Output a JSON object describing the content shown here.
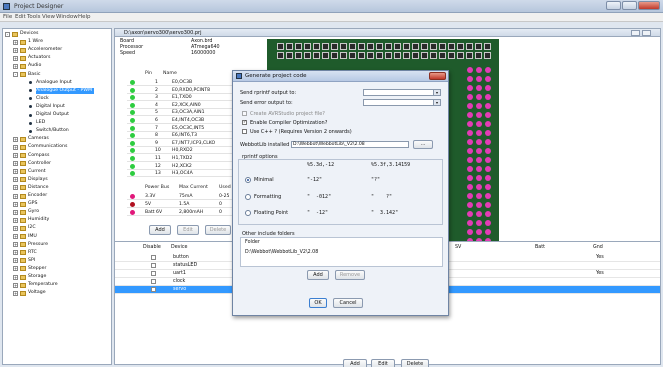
{
  "app": {
    "title": "Project Designer"
  },
  "menu": [
    "File",
    "Edit",
    "Tools",
    "View",
    "Window",
    "Help"
  ],
  "tree": [
    {
      "label": "Devices",
      "level": 0,
      "kind": "folder",
      "toggle": "-"
    },
    {
      "label": "1 Wire",
      "level": 1,
      "kind": "folder",
      "toggle": "+"
    },
    {
      "label": "Accelerometer",
      "level": 1,
      "kind": "folder",
      "toggle": "+"
    },
    {
      "label": "Actuators",
      "level": 1,
      "kind": "folder",
      "toggle": "+"
    },
    {
      "label": "Audio",
      "level": 1,
      "kind": "folder",
      "toggle": "+"
    },
    {
      "label": "Basic",
      "level": 1,
      "kind": "folder",
      "toggle": "-"
    },
    {
      "label": "Analogue Input",
      "level": 2,
      "kind": "leaf"
    },
    {
      "label": "Analogue Output - PWM",
      "level": 2,
      "kind": "leaf",
      "selected": true
    },
    {
      "label": "Clock",
      "level": 2,
      "kind": "leaf"
    },
    {
      "label": "Digital Input",
      "level": 2,
      "kind": "leaf"
    },
    {
      "label": "Digital Output",
      "level": 2,
      "kind": "leaf"
    },
    {
      "label": "LED",
      "level": 2,
      "kind": "leaf"
    },
    {
      "label": "Switch/Button",
      "level": 2,
      "kind": "leaf"
    },
    {
      "label": "Cameras",
      "level": 1,
      "kind": "folder",
      "toggle": "+"
    },
    {
      "label": "Communications",
      "level": 1,
      "kind": "folder",
      "toggle": "+"
    },
    {
      "label": "Compass",
      "level": 1,
      "kind": "folder",
      "toggle": "+"
    },
    {
      "label": "Controller",
      "level": 1,
      "kind": "folder",
      "toggle": "+"
    },
    {
      "label": "Current",
      "level": 1,
      "kind": "folder",
      "toggle": "+"
    },
    {
      "label": "Displays",
      "level": 1,
      "kind": "folder",
      "toggle": "+"
    },
    {
      "label": "Distance",
      "level": 1,
      "kind": "folder",
      "toggle": "+"
    },
    {
      "label": "Encoder",
      "level": 1,
      "kind": "folder",
      "toggle": "+"
    },
    {
      "label": "GPS",
      "level": 1,
      "kind": "folder",
      "toggle": "+"
    },
    {
      "label": "Gyro",
      "level": 1,
      "kind": "folder",
      "toggle": "+"
    },
    {
      "label": "Humidity",
      "level": 1,
      "kind": "folder",
      "toggle": "+"
    },
    {
      "label": "I2C",
      "level": 1,
      "kind": "folder",
      "toggle": "+"
    },
    {
      "label": "IMU",
      "level": 1,
      "kind": "folder",
      "toggle": "+"
    },
    {
      "label": "Pressure",
      "level": 1,
      "kind": "folder",
      "toggle": "+"
    },
    {
      "label": "RTC",
      "level": 1,
      "kind": "folder",
      "toggle": "+"
    },
    {
      "label": "SPI",
      "level": 1,
      "kind": "folder",
      "toggle": "+"
    },
    {
      "label": "Stepper",
      "level": 1,
      "kind": "folder",
      "toggle": "+"
    },
    {
      "label": "Storage",
      "level": 1,
      "kind": "folder",
      "toggle": "+"
    },
    {
      "label": "Temperature",
      "level": 1,
      "kind": "folder",
      "toggle": "+"
    },
    {
      "label": "Voltage",
      "level": 1,
      "kind": "folder",
      "toggle": "+"
    }
  ],
  "doc": {
    "tab": "D:\\axon\\servo300\\servo300.prj",
    "info": [
      {
        "k": "Board",
        "v": "Axon.brd"
      },
      {
        "k": "Processor",
        "v": "ATmega640"
      },
      {
        "k": "Speed",
        "v": "16000000"
      }
    ],
    "pin_headers": {
      "pin": "Pin",
      "name": "Name"
    },
    "pins": [
      {
        "n": "1",
        "name": "E0,OC3B"
      },
      {
        "n": "2",
        "name": "E0,RXD0,PCINT8"
      },
      {
        "n": "3",
        "name": "E1,TXD0"
      },
      {
        "n": "4",
        "name": "E2,XCK,AIN0"
      },
      {
        "n": "5",
        "name": "E3,OC3A,AIN1"
      },
      {
        "n": "6",
        "name": "E4,INT4,OC3B"
      },
      {
        "n": "7",
        "name": "E5,OC3C,INT5"
      },
      {
        "n": "8",
        "name": "E6,INT6,T3"
      },
      {
        "n": "9",
        "name": "E7,INT7,ICP3,CLKO"
      },
      {
        "n": "10",
        "name": "H0,RXD2"
      },
      {
        "n": "11",
        "name": "H1,TXD2"
      },
      {
        "n": "12",
        "name": "H2,XCK2"
      },
      {
        "n": "13",
        "name": "H3,OC4A"
      }
    ],
    "power_headers": {
      "bus": "Power Bus",
      "max": "Max Current",
      "used": "Used"
    },
    "power": [
      {
        "bus": "3.3V",
        "max": "75mA",
        "used": "0-25",
        "color": "#e0187a"
      },
      {
        "bus": "5V",
        "max": "1.5A",
        "used": "0",
        "color": "#b01020"
      },
      {
        "bus": "Batt 6V",
        "max": "2,800mAH",
        "used": "0",
        "color": "#e0187a"
      }
    ],
    "top_buttons": {
      "add": "Add",
      "edit": "Edit",
      "delete": "Delete"
    },
    "device_headers": {
      "disable": "Disable",
      "device": "Device",
      "sv": "SV",
      "batt": "Batt",
      "gnd": "Gnd"
    },
    "devices": [
      {
        "name": "button",
        "gnd": "Yes"
      },
      {
        "name": "statusLED",
        "gnd": ""
      },
      {
        "name": "uart1",
        "gnd": "Yes"
      },
      {
        "name": "clock",
        "gnd": ""
      },
      {
        "name": "servo",
        "gnd": "",
        "selected": true
      }
    ],
    "bottom_buttons": {
      "add": "Add",
      "edit": "Edit",
      "delete": "Delete"
    }
  },
  "dialog": {
    "title": "Generate project code",
    "rprintf_label": "Send rprintf output to:",
    "error_label": "Send error output to:",
    "avrstudio": "Create AVRStudio project file?",
    "optimize": "Enable Compiler Optimization?",
    "cpp": "Use C++ ? (Requires Version 2 onwards)",
    "webbotlib_label": "WebbotLib installed in:",
    "webbotlib_path": "D:\\Webbot\\WebbotLib\\_V2\\2.08",
    "browse": "...",
    "rprintf_options": "rprintf options",
    "hdr1": "%5.3d,-12",
    "hdr2": "%5.3f,3.14159",
    "options": [
      {
        "label": "Minimal",
        "a": "\"-12\"",
        "b": "\"?\"",
        "on": true
      },
      {
        "label": "Formatting",
        "a": "\"  -012\"",
        "b": "\"    ?\"",
        "on": false
      },
      {
        "label": "Floating Point",
        "a": "\"  -12\"",
        "b": "\"  3.142\"",
        "on": false
      }
    ],
    "other_folders": "Other include folders",
    "folder_hdr": "Folder",
    "folder_row": "D:\\Webbot\\WebbotLib_V2\\2.08",
    "add": "Add",
    "remove": "Remove",
    "ok": "OK",
    "cancel": "Cancel"
  }
}
